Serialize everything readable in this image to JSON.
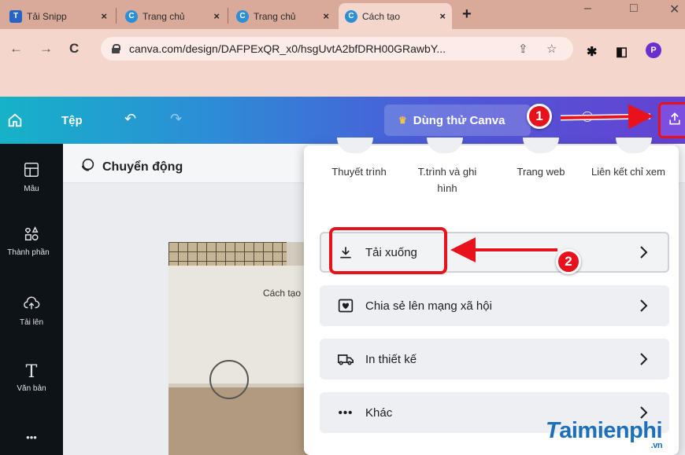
{
  "browser": {
    "tabs": [
      {
        "title": "Tải Snipp",
        "icon": "taimienphi-icon",
        "color": "#2563c7"
      },
      {
        "title": "Trang chủ",
        "icon": "canva-icon",
        "color": "#2c8ed6"
      },
      {
        "title": "Trang chủ",
        "icon": "canva-icon",
        "color": "#2c8ed6"
      },
      {
        "title": "Cách tạo",
        "icon": "canva-icon",
        "color": "#2c8ed6"
      }
    ],
    "url": "canva.com/design/DAFPExQR_x0/hsgUvtA2bfDRH00GRawbY...",
    "profile_letter": "P"
  },
  "header": {
    "file_label": "Tệp",
    "trial_label": "Dùng thử Canva"
  },
  "sidebar": {
    "items": [
      {
        "label": "Mẫu",
        "icon": "template-icon"
      },
      {
        "label": "Thành phần",
        "icon": "elements-icon"
      },
      {
        "label": "Tải lên",
        "icon": "upload-cloud-icon"
      },
      {
        "label": "Văn bản",
        "icon": "text-icon"
      }
    ],
    "more_label": "•••"
  },
  "canvas": {
    "animation_label": "Chuyển động",
    "page_title": "Cách tạo"
  },
  "share_menu": {
    "options": [
      "Thuyết trình",
      "T.trình và ghi hình",
      "Trang web",
      "Liên kết chỉ xem"
    ],
    "items": [
      {
        "label": "Tải xuống",
        "icon": "download-icon"
      },
      {
        "label": "Chia sẻ lên mạng xã hội",
        "icon": "heart-icon"
      },
      {
        "label": "In thiết kế",
        "icon": "truck-icon"
      },
      {
        "label": "Khác",
        "icon": "more-dots-icon"
      }
    ]
  },
  "callouts": {
    "step1": "1",
    "step2": "2"
  },
  "watermark": {
    "text": "aimienphi",
    "suffix": ".vn"
  },
  "colors": {
    "accent": "#7d4fe0",
    "callout": "#e8121c",
    "header_start": "#16b2c8",
    "header_end": "#6541d2"
  }
}
